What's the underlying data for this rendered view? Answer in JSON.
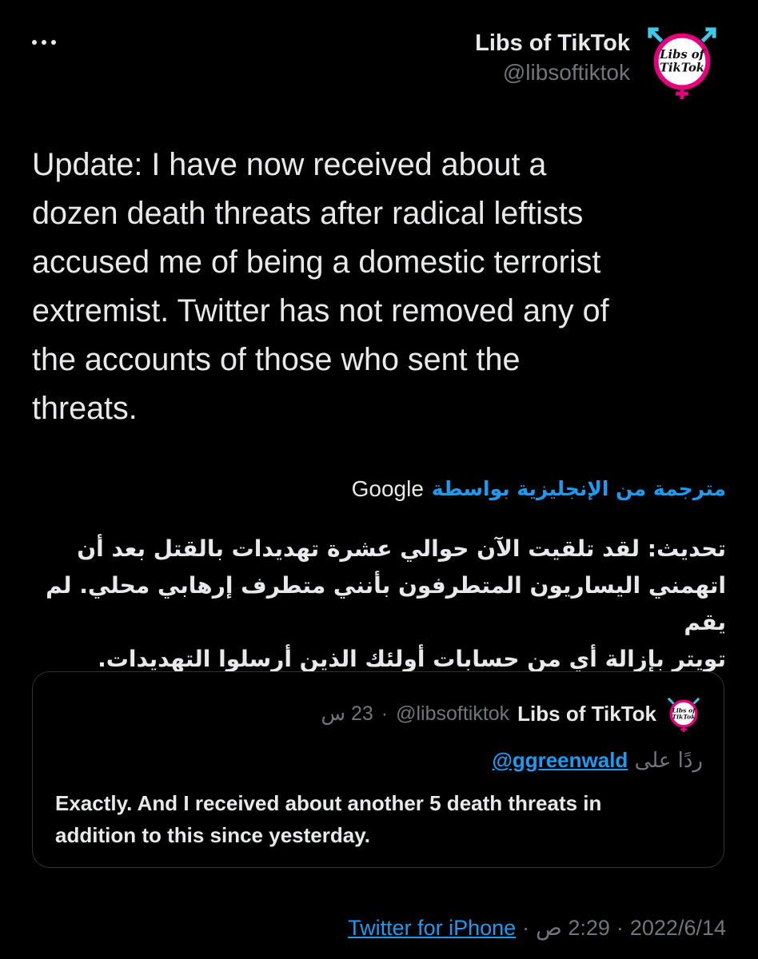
{
  "header": {
    "more_icon": "more-horizontal-icon",
    "author_name": "Libs of TikTok",
    "author_handle": "@libsoftiktok",
    "avatar_text_line1": "Libs of",
    "avatar_text_line2": "TikTok"
  },
  "tweet": {
    "text": "Update: I have now received about a\ndozen death threats after radical leftists\naccused me of being a domestic terrorist\nextremist. Twitter has not removed any of\nthe accounts of those who sent the\nthreats."
  },
  "translation": {
    "label": "مترجمة من الإنجليزية بواسطة",
    "provider": "Google",
    "text": "تحديث: لقد تلقيت الآن حوالي عشرة تهديدات بالقتل بعد أن\nاتهمني اليساريون المتطرفون بأنني متطرف إرهابي محلي. لم يقم\nتويتر بإزالة أي من حسابات أولئك الذين أرسلوا التهديدات."
  },
  "quoted_tweet": {
    "author_name": "Libs of TikTok",
    "author_handle": "@libsoftiktok",
    "separator": "·",
    "time": "23 س",
    "reply_prefix": "ردًا على",
    "reply_handle": "@ggreenwald",
    "text": "Exactly. And I received about another 5 death threats in\naddition to this since yesterday."
  },
  "meta": {
    "date": "2022/6/14",
    "separator": "·",
    "time": "2:29 ص",
    "source": "Twitter for iPhone"
  },
  "colors": {
    "background": "#000000",
    "text": "#e7e9ea",
    "muted": "#71767b",
    "link": "#1d9bf0",
    "border": "#2f3336",
    "avatar_pink": "#e6007e",
    "avatar_cyan": "#41c8e6"
  }
}
